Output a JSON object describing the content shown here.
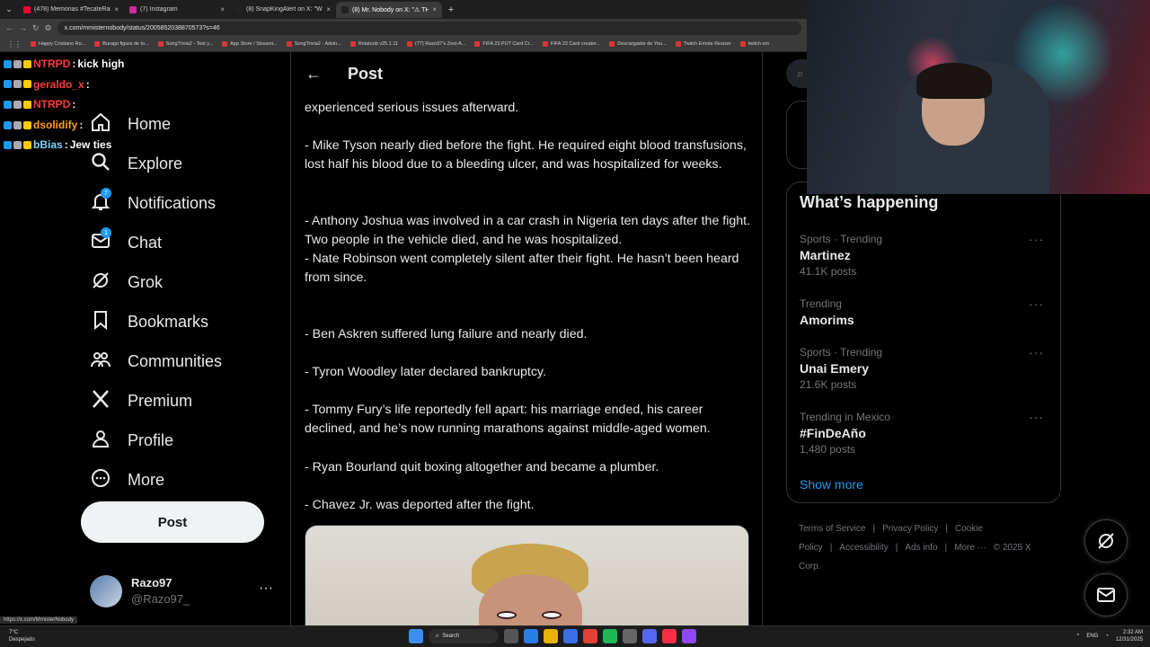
{
  "browser": {
    "tabs": [
      {
        "title": "(478) Memorias #TecateRalNot",
        "color": "#ff0033",
        "active": false
      },
      {
        "title": "(7) Instagram",
        "color": "#d6249f",
        "active": false
      },
      {
        "title": "(8) SnapKingAlert on X: \"Wha",
        "color": "#222222",
        "active": false
      },
      {
        "title": "(8) Mr. Nobody on X: \"⚠ THE",
        "color": "#222222",
        "active": true
      }
    ],
    "url": "x.com/mrnisternobody/status/2005852038870573?s=46",
    "bookmarks": [
      "Happy Cristiano Ro...",
      "Burago figura de to...",
      "SongTrivia2 - Test y...",
      "App Store / Streami...",
      "SongTrivia2 - Advin...",
      "Relatoob v25.1.11",
      "(77) Razo97's Zest-A...",
      "FIFA 23 PUT Card Cr...",
      "FIFA 23 Card creator...",
      "Descargador de You...",
      "Twitch Emote Resizer",
      "twitch em"
    ]
  },
  "chat": [
    {
      "user": "NTRPD",
      "color": "#ff3b3b",
      "msg": "kick high"
    },
    {
      "user": "geraldo_x",
      "color": "#ff3b3b",
      "msg": ""
    },
    {
      "user": "NTRPD",
      "color": "#ff3b3b",
      "msg": ""
    },
    {
      "user": "dsolidify",
      "color": "#ff9f1a",
      "msg": ""
    },
    {
      "user": "bBias",
      "color": "#7fd3ff",
      "msg": "Jew ties"
    }
  ],
  "nav": {
    "items": [
      {
        "label": "Home",
        "icon": "home-icon",
        "badge": ""
      },
      {
        "label": "Explore",
        "icon": "search-icon",
        "badge": ""
      },
      {
        "label": "Notifications",
        "icon": "bell-icon",
        "badge": "7"
      },
      {
        "label": "Chat",
        "icon": "mail-icon",
        "badge": "1"
      },
      {
        "label": "Grok",
        "icon": "grok-icon",
        "badge": ""
      },
      {
        "label": "Bookmarks",
        "icon": "bookmark-icon",
        "badge": ""
      },
      {
        "label": "Communities",
        "icon": "communities-icon",
        "badge": ""
      },
      {
        "label": "Premium",
        "icon": "x-logo-icon",
        "badge": ""
      },
      {
        "label": "Profile",
        "icon": "person-icon",
        "badge": ""
      },
      {
        "label": "More",
        "icon": "more-circle-icon",
        "badge": ""
      }
    ],
    "post_label": "Post"
  },
  "account": {
    "name": "Razo97",
    "handle": "@Razo97_",
    "more": "···"
  },
  "post": {
    "header_title": "Post",
    "paragraphs": [
      "experienced serious issues afterward.",
      "- Mike Tyson nearly died before the fight. He required eight blood transfusions, lost half his blood due to a bleeding ulcer, and was hospitalized for weeks.",
      "- Anthony Joshua was involved in a car crash in Nigeria ten days after the fight. Two people in the vehicle died, and he was hospitalized.",
      "- Nate Robinson went completely silent after their fight. He hasn’t been heard from since.",
      "- Ben Askren suffered lung failure and nearly died.",
      "- Tyron Woodley later declared bankruptcy.",
      "- Tommy Fury’s life reportedly fell apart: his marriage ended, his career declined, and he’s now running marathons against middle-aged women.",
      "- Ryan Bourland quit boxing altogether and became a plumber.",
      "- Chavez Jr. was deported after the fight."
    ]
  },
  "trends": {
    "title": "What’s happening",
    "items": [
      {
        "context": "Sports · Trending",
        "name": "Martinez",
        "count": "41.1K posts"
      },
      {
        "context": "Trending",
        "name": "Amorims",
        "count": ""
      },
      {
        "context": "Sports · Trending",
        "name": "Unai Emery",
        "count": "21.6K posts"
      },
      {
        "context": "Trending in Mexico",
        "name": "#FinDeAño",
        "count": "1,480 posts"
      }
    ],
    "more_dots": "···",
    "show_more": "Show more"
  },
  "footer": {
    "links": [
      "Terms of Service",
      "|",
      "Privacy Policy",
      "|",
      "Cookie Policy",
      "|",
      "Accessibility",
      "|",
      "Ads info",
      "|",
      "More ···",
      "© 2025 X Corp."
    ]
  },
  "status_url": "https://x.com/MrnisterNobody",
  "taskbar": {
    "weather_temp": "7°C",
    "weather_desc": "Despejado",
    "search": "Search",
    "lang": "ENG",
    "time": "2:32 AM",
    "date": "12/31/2025"
  },
  "colors": {
    "accent": "#1d9bf0",
    "border": "#2f3336",
    "muted": "#71767b"
  }
}
